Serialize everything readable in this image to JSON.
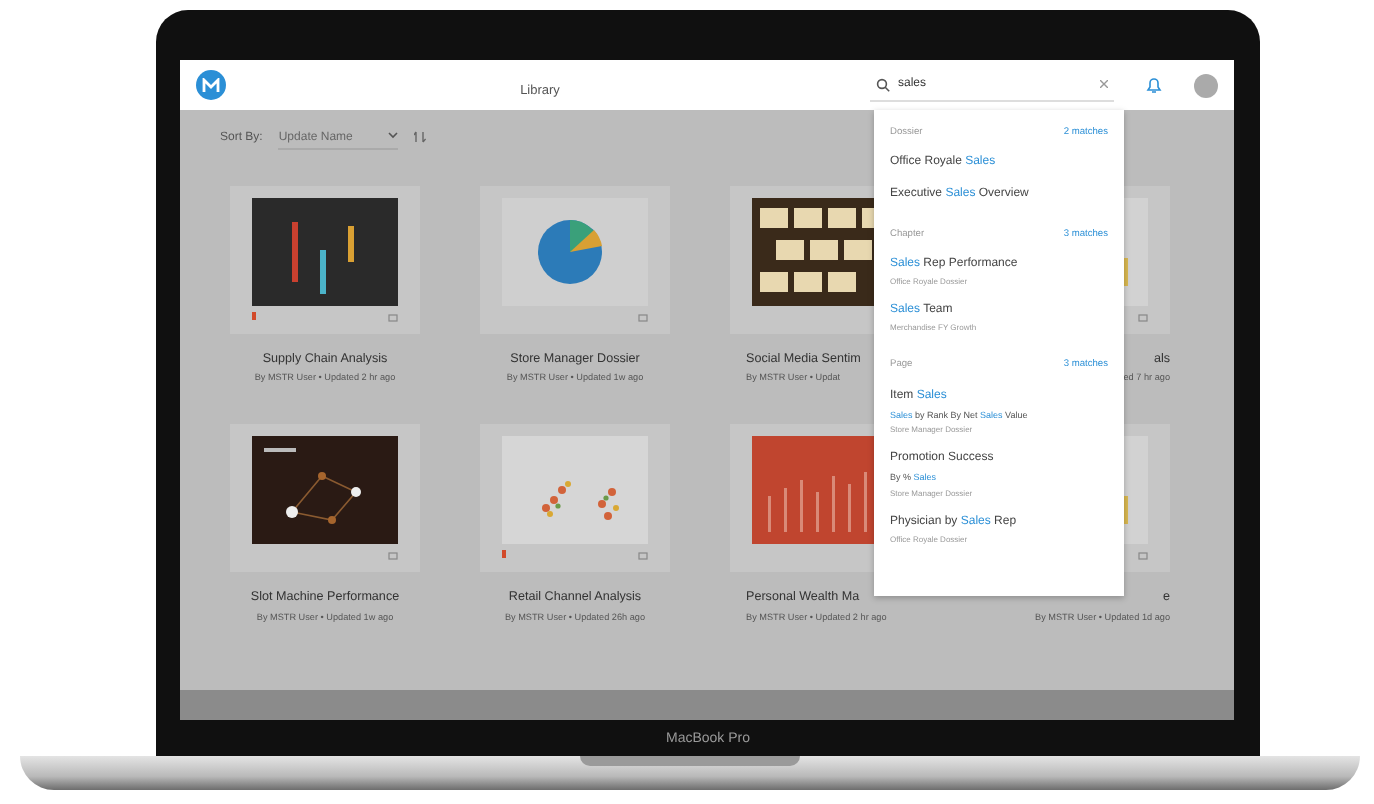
{
  "window": {
    "title": "Library"
  },
  "search": {
    "value": "sales"
  },
  "sort": {
    "label": "Sort By:",
    "value": "Update Name"
  },
  "cards": [
    {
      "title": "Supply Chain Analysis",
      "meta": "By MSTR User • Updated 2 hr ago",
      "kind": "bars",
      "flagged": true
    },
    {
      "title": "Store Manager Dossier",
      "meta": "By MSTR User • Updated 1w ago",
      "kind": "pie",
      "flagged": false
    },
    {
      "title": "Social Media Sentim",
      "meta": "By MSTR User • Updat",
      "kind": "tiles",
      "flagged": false
    },
    {
      "title": "als",
      "meta": "ed 7 hr ago",
      "kind": "light"
    },
    {
      "title": "Slot Machine Performance",
      "meta": "By MSTR User • Updated 1w ago",
      "kind": "network",
      "flagged": false
    },
    {
      "title": "Retail Channel Analysis",
      "meta": "By MSTR User • Updated 26h ago",
      "kind": "scatter",
      "flagged": true
    },
    {
      "title": "Personal Wealth Ma",
      "meta": "By MSTR User • Updated 2 hr ago",
      "kind": "redbars",
      "flagged": false
    },
    {
      "title": "e",
      "meta": "By MSTR User • Updated 1d ago",
      "kind": "light"
    }
  ],
  "search_results": [
    {
      "heading": "Dossier",
      "count": "2 matches",
      "items": [
        {
          "parts": [
            {
              "text": "Office Royale "
            },
            {
              "text": "Sales",
              "match": true
            }
          ]
        },
        {
          "parts": [
            {
              "text": "Executive "
            },
            {
              "text": "Sales",
              "match": true
            },
            {
              "text": " Overview"
            }
          ]
        }
      ]
    },
    {
      "heading": "Chapter",
      "count": "3 matches",
      "items": [
        {
          "parts": [
            {
              "text": "Sales",
              "match": true
            },
            {
              "text": " Rep Performance"
            }
          ],
          "source": "Office Royale Dossier"
        },
        {
          "parts": [
            {
              "text": "Sales",
              "match": true
            },
            {
              "text": " Team"
            }
          ],
          "source": "Merchandise FY Growth"
        }
      ]
    },
    {
      "heading": "Page",
      "count": "3 matches",
      "items": [
        {
          "parts": [
            {
              "text": "Item "
            },
            {
              "text": "Sales",
              "match": true
            }
          ],
          "detail": [
            {
              "text": "Sales",
              "match": true
            },
            {
              "text": " by Rank  By Net "
            },
            {
              "text": "Sales",
              "match": true
            },
            {
              "text": " Value"
            }
          ],
          "source": "Store Manager Dossier"
        },
        {
          "parts": [
            {
              "text": "Promotion Success"
            }
          ],
          "detail": [
            {
              "text": "By % "
            },
            {
              "text": "Sales",
              "match": true
            }
          ],
          "source": "Store Manager Dossier"
        },
        {
          "parts": [
            {
              "text": "Physician by "
            },
            {
              "text": "Sales",
              "match": true
            },
            {
              "text": " Rep"
            }
          ],
          "source": "Office Royale Dossier"
        }
      ]
    }
  ],
  "device": {
    "label": "MacBook Pro"
  }
}
